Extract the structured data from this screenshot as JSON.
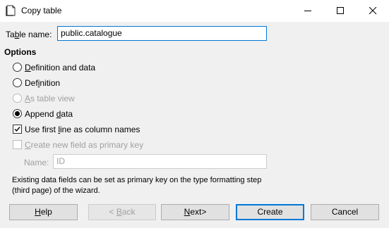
{
  "window": {
    "title": "Copy table",
    "controls": {
      "minimize_icon": "minimize-icon",
      "maximize_icon": "maximize-icon",
      "close_icon": "close-icon"
    }
  },
  "table_name": {
    "label_prefix": "Ta",
    "label_accel": "b",
    "label_suffix": "le name:",
    "value": "public.catalogue"
  },
  "options": {
    "heading": "Options",
    "radios": [
      {
        "pre": "",
        "accel": "D",
        "post": "efinition and data",
        "checked": false,
        "enabled": true
      },
      {
        "pre": "Def",
        "accel": "i",
        "post": "nition",
        "checked": false,
        "enabled": true
      },
      {
        "pre": "",
        "accel": "A",
        "post": "s table view",
        "checked": false,
        "enabled": false
      },
      {
        "pre": "Append ",
        "accel": "d",
        "post": "ata",
        "checked": true,
        "enabled": true
      }
    ],
    "checkboxes": [
      {
        "pre": "Use first ",
        "accel": "l",
        "post": "ine as column names",
        "checked": true,
        "enabled": true
      },
      {
        "pre": "",
        "accel": "C",
        "post": "reate new field as primary key",
        "checked": false,
        "enabled": false
      }
    ],
    "name_field": {
      "label": "Name:",
      "placeholder": "ID"
    },
    "info_line1": "Existing data fields can be set as primary key on the type formatting step",
    "info_line2": "(third page) of the wizard."
  },
  "buttons": {
    "help": {
      "accel": "H",
      "post": "elp"
    },
    "back": {
      "pre": "< ",
      "accel": "B",
      "post": "ack"
    },
    "next": {
      "pre": "",
      "accel": "N",
      "post": "ext>"
    },
    "create": {
      "label": "Create"
    },
    "cancel": {
      "label": "Cancel"
    }
  }
}
